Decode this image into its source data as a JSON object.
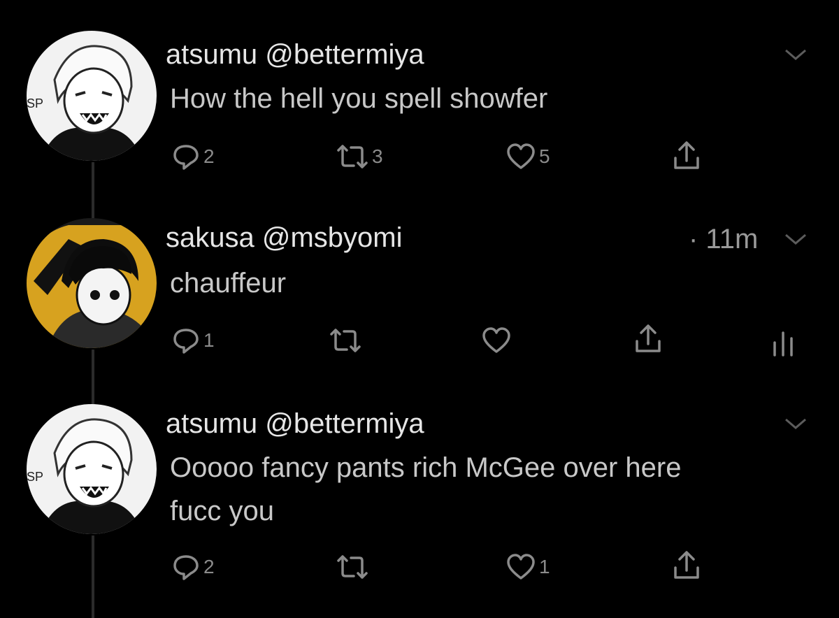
{
  "tweets": [
    {
      "display_name": "atsumu",
      "handle": "@bettermiya",
      "text": [
        "How the hell you spell showfer"
      ],
      "time": "",
      "replies": "2",
      "retweets": "3",
      "likes": "5"
    },
    {
      "display_name": "sakusa",
      "handle": "@msbyomi",
      "text": [
        "chauffeur"
      ],
      "time": "· 11m",
      "replies": "1",
      "retweets": "",
      "likes": ""
    },
    {
      "display_name": "atsumu",
      "handle": "@bettermiya",
      "text": [
        "Ooooo fancy pants rich McGee over here",
        "fucc you"
      ],
      "time": "",
      "replies": "2",
      "retweets": "",
      "likes": "1"
    }
  ],
  "icons": {
    "reply": "reply-icon",
    "retweet": "retweet-icon",
    "like": "heart-icon",
    "share": "share-icon",
    "analytics": "analytics-icon",
    "more": "chevron-down-icon"
  },
  "colors": {
    "background": "#000000",
    "text_primary": "#e6e6e6",
    "text_secondary": "#8b8b8b",
    "avatar_accent": "#d7a21f"
  }
}
